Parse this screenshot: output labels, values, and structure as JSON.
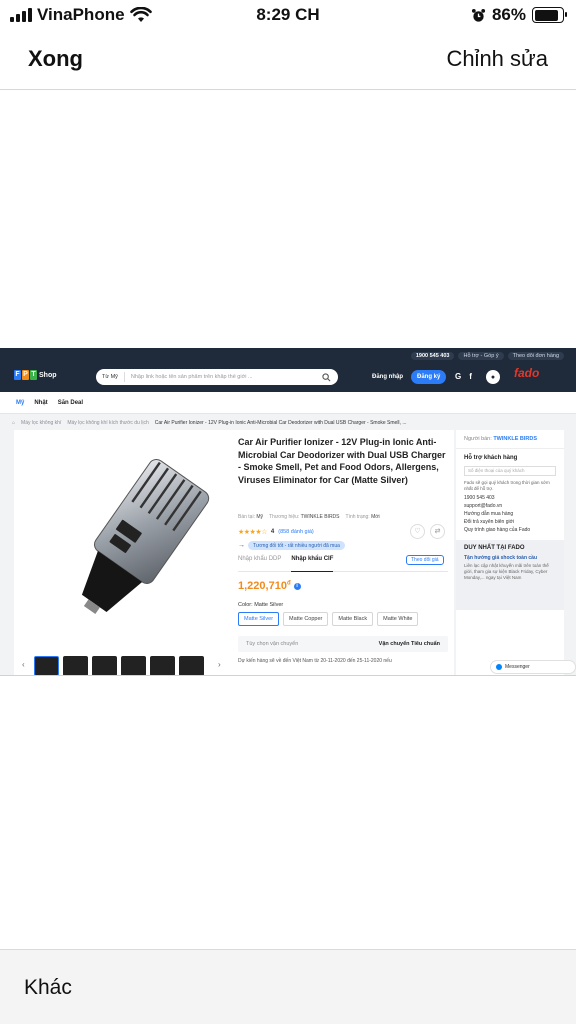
{
  "status_bar": {
    "carrier": "VinaPhone",
    "time": "8:29 CH",
    "battery": "86%",
    "battery_level": 0.86
  },
  "nav": {
    "done": "Xong",
    "edit": "Chỉnh sửa"
  },
  "screenshot": {
    "header": {
      "hotline": "1900 545 403",
      "support_link": "Hỗ trợ - Góp ý",
      "track_link": "Theo dõi đơn hàng",
      "logo_text": "Shop",
      "search_scope": "Từ Mỹ",
      "search_placeholder": "Nhập link hoặc tên sản phẩm trên khắp thế giới ...",
      "login": "Đăng nhập",
      "register": "Đăng ký",
      "fado": "fado"
    },
    "subnav": [
      "Mỹ",
      "Nhật",
      "Săn Deal"
    ],
    "breadcrumbs": [
      "Máy lọc không khí",
      "Máy lọc không khí kích thước du lịch",
      "Car Air Purifier Ionizer - 12V Plug-in Ionic Anti-Microbial Car Deodorizer with Dual USB Charger - Smoke Smell, ..."
    ],
    "product": {
      "title": "Car Air Purifier Ionizer - 12V Plug-in Ionic Anti-Microbial Car Deodorizer with Dual USB Charger - Smoke Smell, Pet and Food Odors, Allergens, Viruses Eliminator for Car (Matte Silver)",
      "sold_at_label": "Bán tại:",
      "sold_at": "Mỹ",
      "brand_label": "Thương hiệu:",
      "brand": "TWINKLE BIRDS",
      "condition_label": "Tình trạng:",
      "condition": "Mới",
      "rating": "4",
      "rating_value": 4,
      "reviews": "(858 đánh giá)",
      "tag": "Tương đối tốt - rất nhiều người đã mua",
      "tab_ddp": "Nhập khẩu DDP",
      "tab_cif": "Nhập khẩu CIF",
      "track_price": "Theo dõi giá",
      "price": "1,220,710",
      "currency": "đ",
      "color_label": "Color: Matte Silver",
      "colors": [
        "Matte Silver",
        "Matte Copper",
        "Matte Black",
        "Matte White"
      ],
      "shipping_label": "Tùy chọn vận chuyển",
      "shipping_value": "Vận chuyển Tiêu chuẩn",
      "estimate": "Dự kiến hàng sẽ về đến Việt Nam từ 20-11-2020 đến 25-11-2020 nếu"
    },
    "sidebar": {
      "seller_label": "Người bán:",
      "seller": "TWINKLE BIRDS",
      "support_title": "Hỗ trợ khách hàng",
      "support_placeholder": "Số điện thoại của quý khách",
      "support_desc": "Fado sẽ gọi quý khách trong thời gian sớm nhất để hỗ trợ.",
      "phone": "1900 545 403",
      "email": "support@fado.vn",
      "guide": "Hướng dẫn mua hàng",
      "returns": "Đổi trả xuyên biên giới",
      "process": "Quy trình giao hàng của Fado",
      "only_title": "DUY NHẤT TẠI FADO",
      "only_sub": "Tận hưởng giá shock toàn cầu",
      "only_desc": "Liên lạc cập nhật khuyến mãi trên toàn thế giới, tham gia sự kiện Black Friday, Cyber Monday,... ngay tại Việt Nam"
    },
    "messenger": "Messenger"
  },
  "bottom": {
    "other": "Khác"
  }
}
